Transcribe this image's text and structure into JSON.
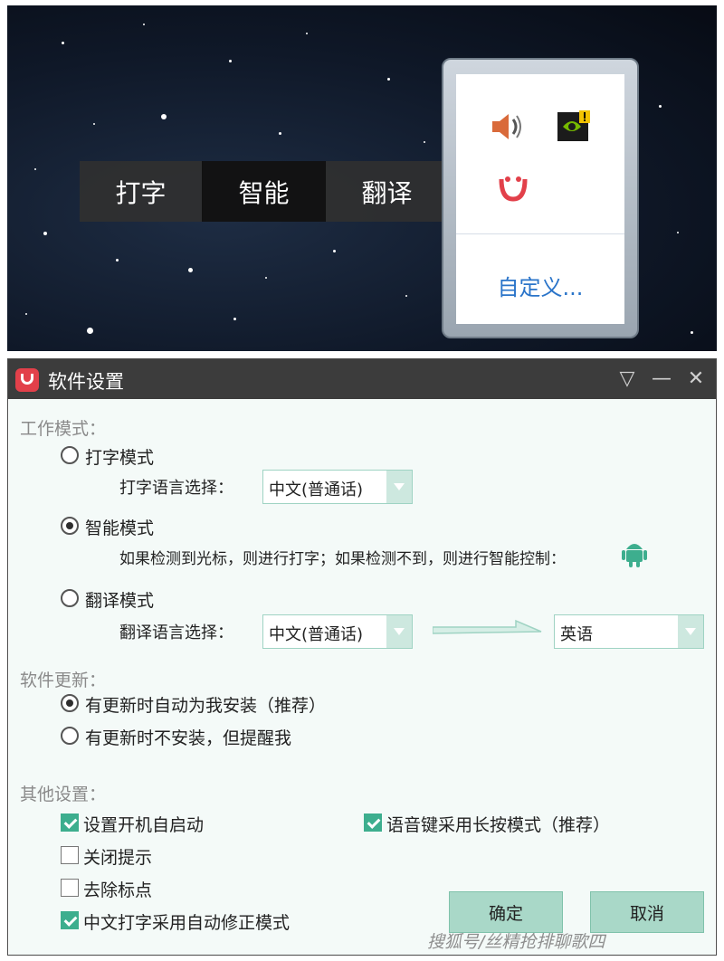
{
  "mode_bar": {
    "items": [
      {
        "label": "打字",
        "active": false
      },
      {
        "label": "智能",
        "active": true
      },
      {
        "label": "翻译",
        "active": false
      }
    ],
    "settings_icon": "gear-icon"
  },
  "tray": {
    "icons": [
      "speaker-icon",
      "nvidia-warning-icon",
      "app-tray-icon"
    ],
    "customize_label": "自定义..."
  },
  "window": {
    "title": "软件设置",
    "controls": [
      "dropdown-triangle-icon",
      "minimize-icon",
      "close-icon"
    ]
  },
  "work_mode": {
    "heading": "工作模式：",
    "typing": {
      "label": "打字模式",
      "selected": false,
      "lang_label": "打字语言选择：",
      "lang_value": "中文(普通话)"
    },
    "smart": {
      "label": "智能模式",
      "selected": true,
      "description": "如果检测到光标，则进行打字；如果检测不到，则进行智能控制：",
      "icon": "android-icon"
    },
    "translate": {
      "label": "翻译模式",
      "selected": false,
      "lang_label": "翻译语言选择：",
      "source_value": "中文(普通话)",
      "target_value": "英语"
    }
  },
  "software_update": {
    "heading": "软件更新：",
    "options": [
      {
        "label": "有更新时自动为我安装（推荐）",
        "selected": true
      },
      {
        "label": "有更新时不安装，但提醒我",
        "selected": false
      }
    ]
  },
  "other_settings": {
    "heading": "其他设置：",
    "options": [
      {
        "label": "设置开机自启动",
        "checked": true
      },
      {
        "label": "关闭提示",
        "checked": false
      },
      {
        "label": "去除标点",
        "checked": false
      },
      {
        "label": "中文打字采用自动修正模式",
        "checked": true
      },
      {
        "label": "语音键采用长按模式（推荐）",
        "checked": true
      }
    ]
  },
  "buttons": {
    "ok": "确定",
    "cancel": "取消"
  },
  "watermark": "搜狐号/丝精抢排聊歌四",
  "colors": {
    "accent": "#3dae8e",
    "button": "#a9d8c8",
    "titlebar": "#3c3c3c",
    "link": "#2a74c9"
  }
}
